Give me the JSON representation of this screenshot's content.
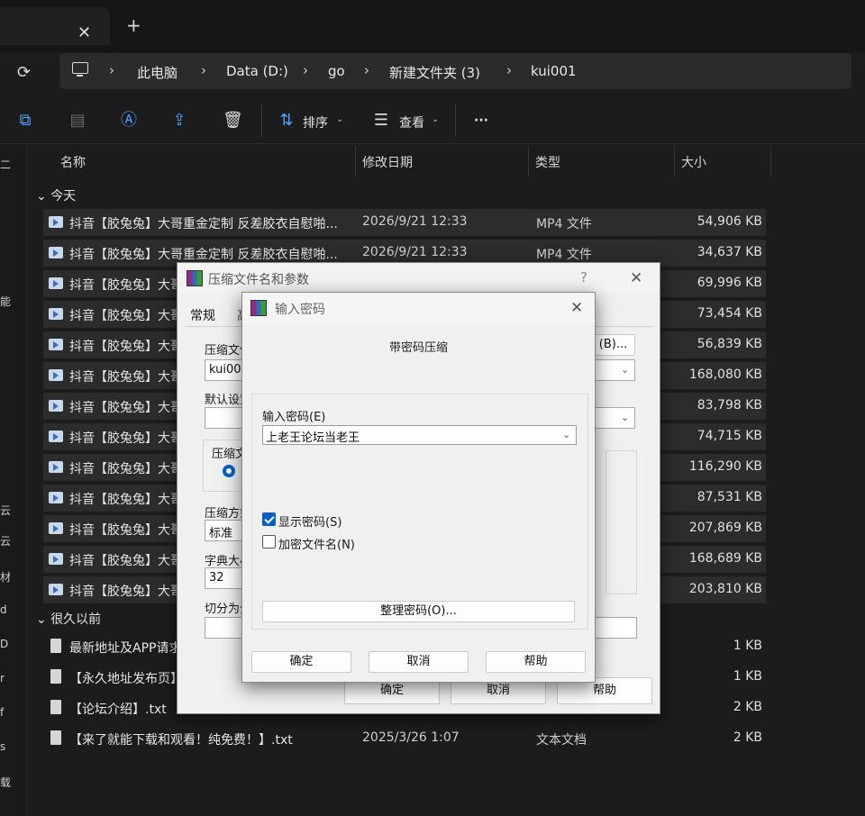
{
  "tabbar": {
    "close_glyph": "✕",
    "add_glyph": "+"
  },
  "address": {
    "refresh_icon": "refresh-icon",
    "crumbs": [
      "此电脑",
      "Data (D:)",
      "go",
      "新建文件夹 (3)",
      "kui001"
    ],
    "separator": "›"
  },
  "toolbar": {
    "sort_label": "排序",
    "view_label": "查看",
    "more_label": "···"
  },
  "left_nav_glyphs": [
    "二",
    "能",
    "云",
    "云",
    "材",
    "d",
    "D",
    "r",
    "f",
    "s",
    "载"
  ],
  "columns": {
    "name": "名称",
    "date": "修改日期",
    "type": "类型",
    "size": "大小"
  },
  "groups": {
    "today": "今天",
    "long_ago": "很久以前"
  },
  "today_files": [
    {
      "name": "抖音【胶兔兔】大哥重金定制 反差胶衣自慰啪...",
      "date": "2026/9/21 12:33",
      "type": "MP4 文件",
      "size": "54,906 KB"
    },
    {
      "name": "抖音【胶兔兔】大哥重金定制 反差胶衣自慰啪...",
      "date": "2026/9/21 12:33",
      "type": "MP4 文件",
      "size": "34,637 KB"
    },
    {
      "name": "抖音【胶兔兔】大哥",
      "date": "",
      "type": "",
      "size": "69,996 KB"
    },
    {
      "name": "抖音【胶兔兔】大哥",
      "date": "",
      "type": "",
      "size": "73,454 KB"
    },
    {
      "name": "抖音【胶兔兔】大哥",
      "date": "",
      "type": "",
      "size": "56,839 KB"
    },
    {
      "name": "抖音【胶兔兔】大哥",
      "date": "",
      "type": "",
      "size": "168,080 KB"
    },
    {
      "name": "抖音【胶兔兔】大哥",
      "date": "",
      "type": "",
      "size": "83,798 KB"
    },
    {
      "name": "抖音【胶兔兔】大哥",
      "date": "",
      "type": "",
      "size": "74,715 KB"
    },
    {
      "name": "抖音【胶兔兔】大哥",
      "date": "",
      "type": "",
      "size": "116,290 KB"
    },
    {
      "name": "抖音【胶兔兔】大哥",
      "date": "",
      "type": "",
      "size": "87,531 KB"
    },
    {
      "name": "抖音【胶兔兔】大哥",
      "date": "",
      "type": "",
      "size": "207,869 KB"
    },
    {
      "name": "抖音【胶兔兔】大哥",
      "date": "",
      "type": "",
      "size": "168,689 KB"
    },
    {
      "name": "抖音【胶兔兔】大哥",
      "date": "",
      "type": "",
      "size": "203,810 KB"
    }
  ],
  "old_files": [
    {
      "name": "最新地址及APP请求",
      "date": "",
      "type": "",
      "size": "1 KB"
    },
    {
      "name": "【永久地址发布页】",
      "date": "",
      "type": "",
      "size": "1 KB"
    },
    {
      "name": "【论坛介绍】.txt",
      "date": "",
      "type": "",
      "size": "2 KB"
    },
    {
      "name": "【来了就能下载和观看！纯免费！】.txt",
      "date": "2025/3/26 1:07",
      "type": "文本文档",
      "size": "2 KB"
    }
  ],
  "archive_dialog": {
    "title": "压缩文件名和参数",
    "help_glyph": "?",
    "close_glyph": "✕",
    "tab_general": "常规",
    "tab_advanced": "高",
    "label_archive_name": "压缩文件",
    "archive_name_value": "kui001",
    "browse_label": "(B)...",
    "label_default": "默认设置",
    "label_format": "压缩文",
    "label_method": "压缩方式",
    "method_value": "标准",
    "label_dict": "字典大小",
    "dict_value": "32",
    "label_split": "切分为分",
    "ok": "确定",
    "cancel": "取消",
    "help": "帮助"
  },
  "password_dialog": {
    "title": "输入密码",
    "close_glyph": "✕",
    "heading": "带密码压缩",
    "label_enter": "输入密码(E)",
    "password_value": "上老王论坛当老王",
    "show_password_label": "显示密码(S)",
    "show_password_checked": true,
    "encrypt_names_label": "加密文件名(N)",
    "encrypt_names_checked": false,
    "organize_button": "整理密码(O)...",
    "ok": "确定",
    "cancel": "取消",
    "help": "帮助"
  }
}
